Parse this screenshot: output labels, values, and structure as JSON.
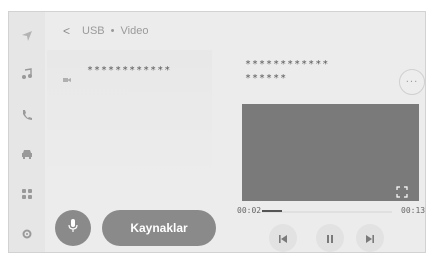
{
  "breadcrumb": {
    "back_label": "<",
    "source": "USB",
    "separator": "•",
    "page": "Video"
  },
  "sidebar": {
    "items": [
      {
        "name": "navigation",
        "icon": "navigation-arrow-icon"
      },
      {
        "name": "music",
        "icon": "music-note-icon"
      },
      {
        "name": "phone",
        "icon": "phone-icon"
      },
      {
        "name": "vehicle",
        "icon": "car-icon"
      },
      {
        "name": "apps",
        "icon": "apps-grid-icon"
      },
      {
        "name": "settings",
        "icon": "settings-gear-icon"
      }
    ]
  },
  "left_panel": {
    "item_text": "************"
  },
  "now_playing": {
    "title": "************",
    "subtitle": "******",
    "more_label": "···"
  },
  "player": {
    "elapsed": "00:02",
    "total": "00:13",
    "progress": 0.15
  },
  "buttons": {
    "sources_label": "Kaynaklar"
  },
  "colors": {
    "background": "#ececec",
    "button": "#8a8a8a",
    "video": "#7a7a7a",
    "icon": "#9a9a9a"
  }
}
